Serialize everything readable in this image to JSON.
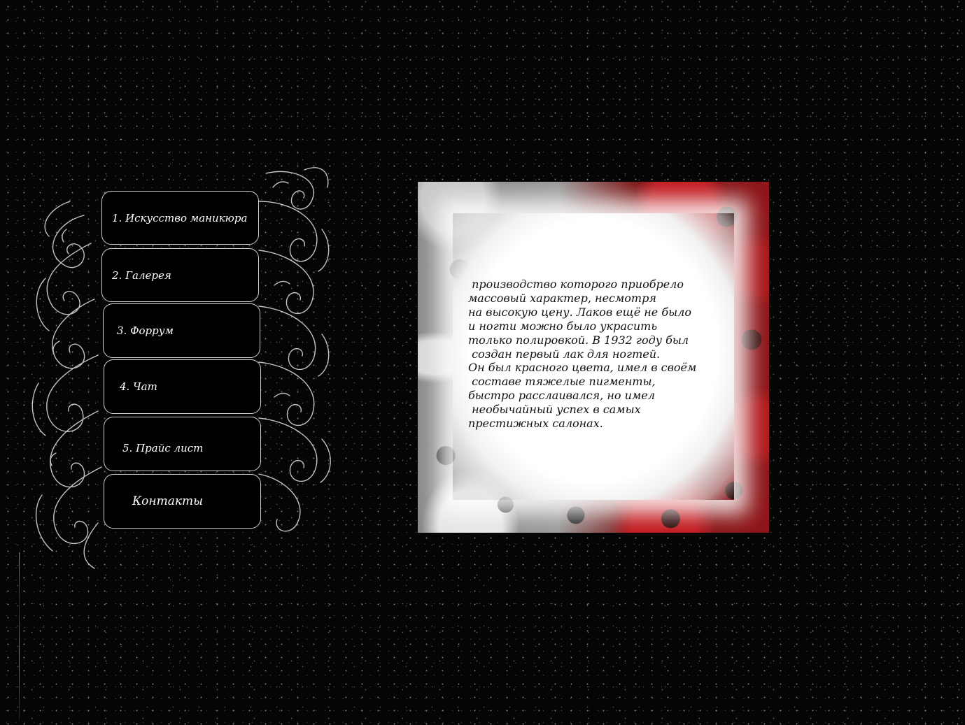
{
  "menu": {
    "items": [
      {
        "label": "1. Искусство маникюра"
      },
      {
        "label": "2. Галерея"
      },
      {
        "label": "3. Форрум"
      },
      {
        "label": "4. Чат"
      },
      {
        "label": "5. Прайс лист"
      },
      {
        "label": "Контакты"
      }
    ]
  },
  "content": {
    "lines": [
      " производство которого приобрело",
      "массовый характер, несмотря",
      "на высокую цену. Лаков ещё не было",
      "и ногти можно было украсить",
      "только полировкой. В 1932 году был",
      " создан первый лак для ногтей.",
      "Он был красного цвета, имел в своём",
      " составе тяжелые пигменты,",
      "быстро расслаивался, но имел",
      " необычайный успех в самых",
      "престижных салонах."
    ]
  },
  "colors": {
    "background": "#050505",
    "menu_button_bg": "#000000",
    "menu_button_border": "#cfcfcf",
    "menu_text": "#ffffff",
    "frame_red": "#c0171c",
    "card_text": "#111111"
  }
}
